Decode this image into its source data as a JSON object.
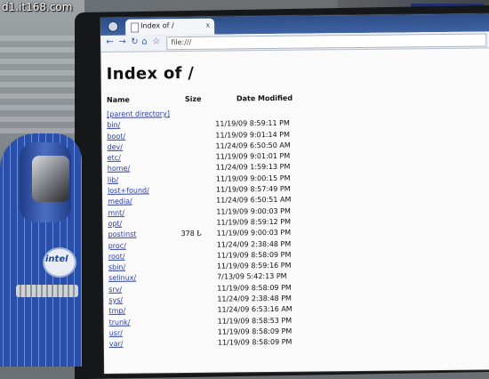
{
  "watermark": "d1.it168.com",
  "tab_title": "Index of /",
  "tab_close": "x",
  "url": "file:///",
  "page_title": "Index of /",
  "columns": {
    "name": "Name",
    "size": "Size",
    "modified": "Date Modified"
  },
  "rows": [
    {
      "name": "[parent directory]",
      "size": "",
      "date": ""
    },
    {
      "name": "bin/",
      "size": "",
      "date": "11/19/09 8:59:11 PM"
    },
    {
      "name": "boot/",
      "size": "",
      "date": "11/19/09 9:01:14 PM"
    },
    {
      "name": "dev/",
      "size": "",
      "date": "11/24/09 6:50:50 AM"
    },
    {
      "name": "etc/",
      "size": "",
      "date": "11/19/09 9:01:01 PM"
    },
    {
      "name": "home/",
      "size": "",
      "date": "11/24/09 1:59:13 PM"
    },
    {
      "name": "lib/",
      "size": "",
      "date": "11/19/09 9:00:15 PM"
    },
    {
      "name": "lost+found/",
      "size": "",
      "date": "11/19/09 8:57:49 PM"
    },
    {
      "name": "media/",
      "size": "",
      "date": "11/24/09 6:50:51 AM"
    },
    {
      "name": "mnt/",
      "size": "",
      "date": "11/19/09 9:00:03 PM"
    },
    {
      "name": "opt/",
      "size": "",
      "date": "11/19/09 8:59:12 PM"
    },
    {
      "name": "postinst",
      "size": "378 B",
      "date": "11/19/09 9:00:03 PM"
    },
    {
      "name": "proc/",
      "size": "",
      "date": "11/24/09 2:38:48 PM"
    },
    {
      "name": "root/",
      "size": "",
      "date": "11/19/09 8:58:09 PM"
    },
    {
      "name": "sbin/",
      "size": "",
      "date": "11/19/09 8:59:16 PM"
    },
    {
      "name": "selinux/",
      "size": "",
      "date": "7/13/09 5:42:13 PM"
    },
    {
      "name": "srv/",
      "size": "",
      "date": "11/19/09 8:58:09 PM"
    },
    {
      "name": "sys/",
      "size": "",
      "date": "11/24/09 2:38:48 PM"
    },
    {
      "name": "tmp/",
      "size": "",
      "date": "11/24/09 6:53:16 AM"
    },
    {
      "name": "trunk/",
      "size": "",
      "date": "11/19/09 8:58:53 PM"
    },
    {
      "name": "usr/",
      "size": "",
      "date": "11/19/09 8:58:09 PM"
    },
    {
      "name": "var/",
      "size": "",
      "date": "11/19/09 8:58:09 PM"
    }
  ],
  "icons": {
    "app": "chrome-icon",
    "tab": "page-icon",
    "back": "back-arrow-icon",
    "forward": "forward-arrow-icon",
    "reload": "reload-icon",
    "home": "home-icon",
    "bookmark": "star-icon",
    "cursor": "mouse-cursor-icon"
  },
  "colors": {
    "tab_strip": "#2d4d86",
    "link": "#2a3ea8",
    "page_bg": "#fafafa"
  }
}
